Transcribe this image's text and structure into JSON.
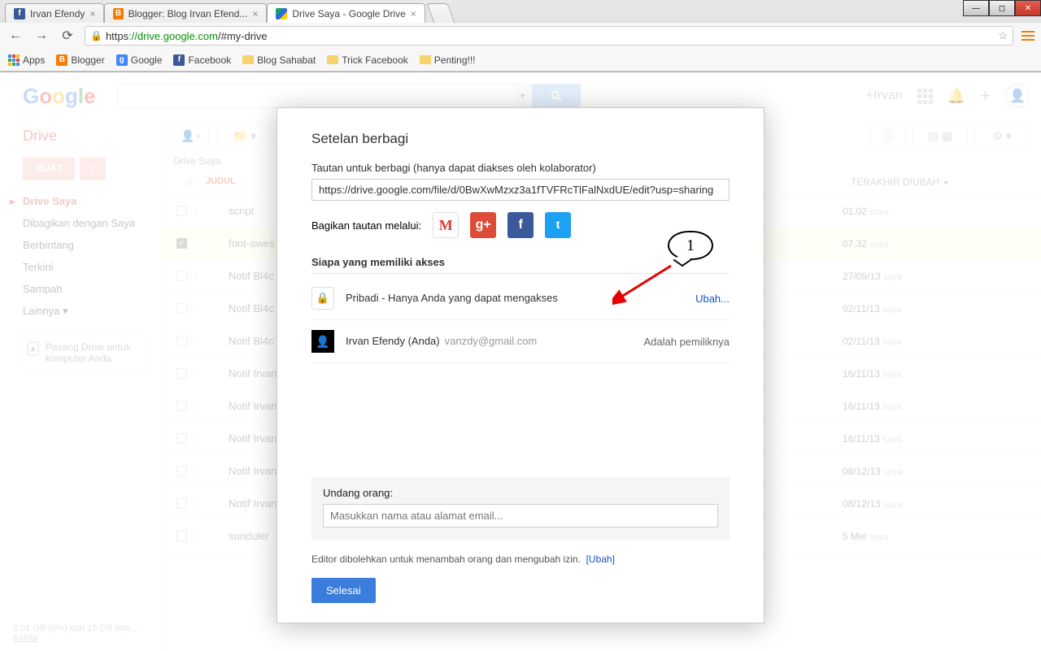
{
  "browser": {
    "tabs": [
      {
        "title": "Irvan Efendy",
        "icon": "facebook"
      },
      {
        "title": "Blogger: Blog Irvan Efend...",
        "icon": "blogger"
      },
      {
        "title": "Drive Saya - Google Drive",
        "icon": "drive",
        "active": true
      }
    ],
    "url_prefix": "https",
    "url_host": "://drive.google.com",
    "url_path": "/#my-drive",
    "bookmarks": [
      "Apps",
      "Blogger",
      "Google",
      "Facebook",
      "Blog Sahabat",
      "Trick Facebook",
      "Penting!!!"
    ]
  },
  "header": {
    "logo": "Google",
    "user_label": "+Irvan"
  },
  "sidebar": {
    "product": "Drive",
    "buat": "BUAT",
    "items": [
      "Drive Saya",
      "Dibagikan dengan Saya",
      "Berbintang",
      "Terkini",
      "Sampah",
      "Lainnya ▾"
    ],
    "install_text": "Pasang Drive untuk komputer Anda",
    "storage": "0,01 GB (0%) dari 15 GB terp...",
    "storage_link": "Kelola"
  },
  "content": {
    "breadcrumb": "Drive Saya",
    "col_title": "JUDUL",
    "col_date": "TERAKHIR DIUBAH",
    "date_by": "saya",
    "rows": [
      {
        "icon": "folder",
        "name": "script",
        "date": "01.02",
        "sel": false
      },
      {
        "icon": "doc",
        "name": "font-awes",
        "date": "07.32",
        "sel": true
      },
      {
        "icon": "share",
        "name": "Notif Bl4c",
        "date": "27/09/13",
        "sel": false
      },
      {
        "icon": "share",
        "name": "Notif Bl4c",
        "date": "02/11/13",
        "sel": false
      },
      {
        "icon": "share",
        "name": "Notif Bl4c",
        "date": "02/11/13",
        "sel": false
      },
      {
        "icon": "share",
        "name": "Notif Irvan",
        "date": "16/11/13",
        "sel": false
      },
      {
        "icon": "share",
        "name": "Notif Irvan",
        "date": "16/11/13",
        "sel": false
      },
      {
        "icon": "share",
        "name": "Notif Irvan",
        "date": "16/11/13",
        "sel": false
      },
      {
        "icon": "share",
        "name": "Notif Irvan",
        "date": "08/12/13",
        "sel": false
      },
      {
        "icon": "share",
        "name": "Notif Irvan",
        "date": "08/12/13",
        "sel": false
      },
      {
        "icon": "share",
        "name": "sunduler",
        "date": "5 Mei",
        "sel": false
      }
    ]
  },
  "modal": {
    "title": "Setelan berbagi",
    "link_label": "Tautan untuk berbagi (hanya dapat diakses oleh kolaborator)",
    "link_value": "https://drive.google.com/file/d/0BwXwMzxz3a1fTVFRcTlFalNxdUE/edit?usp=sharing",
    "share_via": "Bagikan tautan melalui:",
    "access_title": "Siapa yang memiliki akses",
    "access_private": "Pribadi - Hanya Anda yang dapat mengakses",
    "ubah": "Ubah...",
    "owner_name": "Irvan Efendy (Anda)",
    "owner_mail": "vanzdy@gmail.com",
    "owner_status": "Adalah pemiliknya",
    "invite_label": "Undang orang:",
    "invite_placeholder": "Masukkan nama atau alamat email...",
    "editor_note": "Editor dibolehkan untuk menambah orang dan mengubah izin.",
    "editor_ubah": "[Ubah]",
    "done": "Selesai"
  },
  "callout": "1"
}
